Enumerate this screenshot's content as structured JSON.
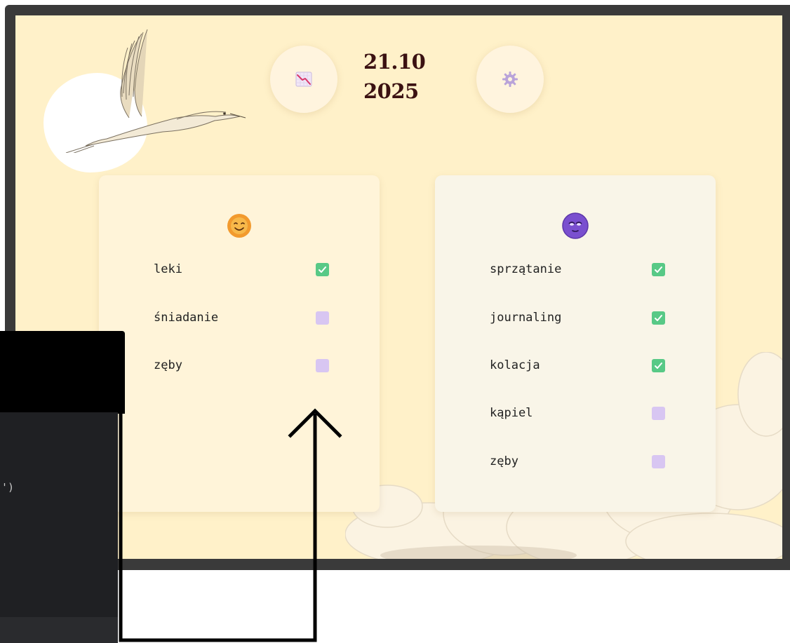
{
  "header": {
    "date_line1": "21.10",
    "date_line2": "2025",
    "stats_button_icon": "chart-down-icon",
    "settings_button_icon": "gear-icon"
  },
  "morning": {
    "emoji_icon": "smiling-sun-icon",
    "tasks": [
      {
        "label": "leki",
        "checked": true
      },
      {
        "label": "śniadanie",
        "checked": false
      },
      {
        "label": "zęby",
        "checked": false
      }
    ]
  },
  "evening": {
    "emoji_icon": "moon-face-icon",
    "tasks": [
      {
        "label": "sprzątanie",
        "checked": true
      },
      {
        "label": "journaling",
        "checked": true
      },
      {
        "label": "kolacja",
        "checked": true
      },
      {
        "label": "kąpiel",
        "checked": false
      },
      {
        "label": "zęby",
        "checked": false
      }
    ]
  },
  "editor": {
    "code_fragment": "')"
  },
  "colors": {
    "background": "#fff1c9",
    "checked": "#58c986",
    "unchecked": "#d8c6f2",
    "date_text": "#3b1212"
  }
}
